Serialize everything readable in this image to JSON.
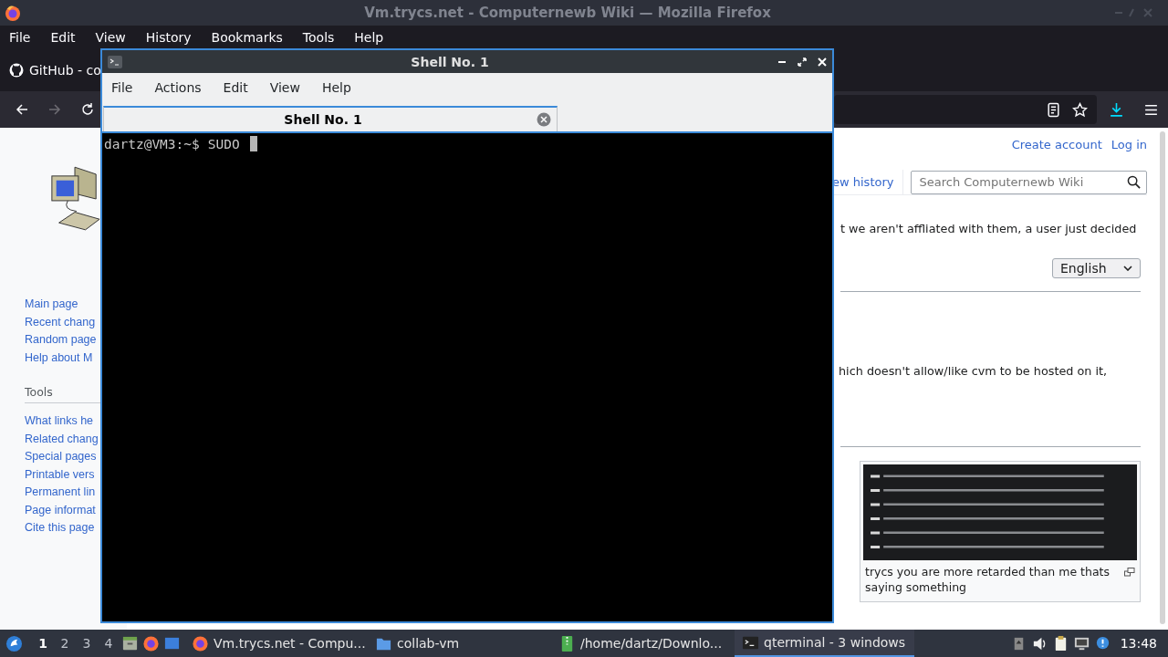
{
  "firefox": {
    "title": "Vm.trycs.net - Computernewb Wiki — Mozilla Firefox",
    "menu": [
      "File",
      "Edit",
      "View",
      "History",
      "Bookmarks",
      "Tools",
      "Help"
    ],
    "tab": {
      "label": "GitHub - co"
    },
    "wiki": {
      "nav_links": [
        "Main page",
        "Recent chang",
        "Random page",
        "Help about M"
      ],
      "tools_heading": "Tools",
      "tools_links": [
        "What links he",
        "Related chang",
        "Special pages",
        "Printable vers",
        "Permanent lin",
        "Page informat",
        "Cite this page"
      ],
      "personal_links": [
        "Create account",
        "Log in"
      ],
      "view_tab": "ew history",
      "search": {
        "placeholder": "Search Computernewb Wiki"
      },
      "paragraph_1": "t we aren't affliated with them, a user just decided",
      "language": "English",
      "paragraph_2": "hich doesn't allow/like cvm to be hosted on it,",
      "figure": {
        "kind": "picture",
        "caption": "trycs you are more retarded than me thats saying something"
      }
    }
  },
  "terminal": {
    "title": "Shell No. 1",
    "menu": [
      "File",
      "Actions",
      "Edit",
      "View",
      "Help"
    ],
    "tabs": [
      {
        "label": "Shell No. 1",
        "selected": true
      }
    ],
    "prompt": "dartz@VM3:~$",
    "command": "SUDO"
  },
  "taskbar": {
    "workspaces": [
      {
        "label": "1",
        "selected": true
      },
      {
        "label": "2",
        "selected": false
      },
      {
        "label": "3",
        "selected": false
      },
      {
        "label": "4",
        "selected": false
      }
    ],
    "tasks": [
      {
        "label": "Vm.trycs.net - Compu...",
        "kind": "browser",
        "selected": false
      },
      {
        "label": "collab-vm",
        "kind": "folder",
        "selected": false
      },
      {
        "label": "/home/dartz/Downlo...",
        "kind": "archive",
        "selected": false
      },
      {
        "label": "qterminal - 3 windows",
        "kind": "terminal",
        "selected": true
      }
    ],
    "clock": "13:48"
  }
}
